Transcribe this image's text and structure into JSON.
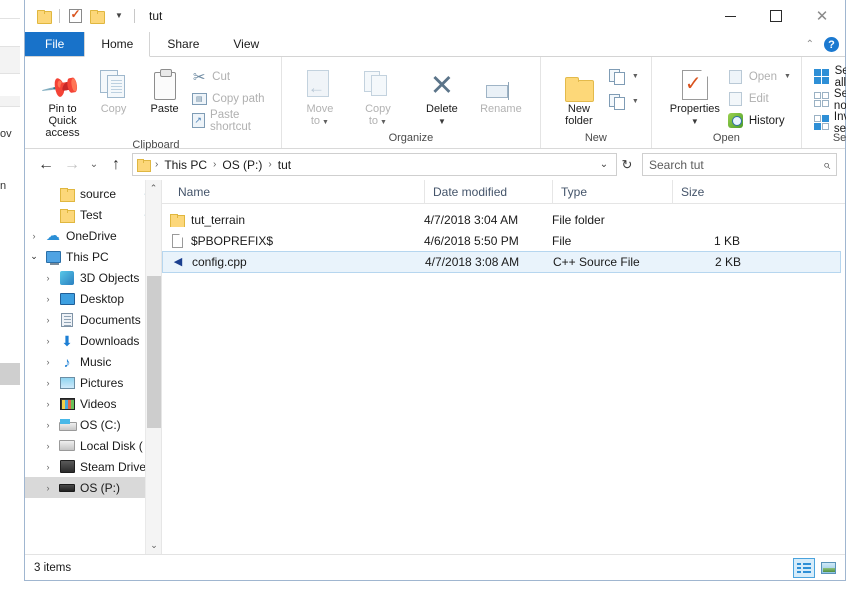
{
  "window": {
    "title": "tut",
    "controls": {
      "minimize": "minimize-button",
      "maximize": "maximize-button",
      "close": "close-button"
    }
  },
  "quick_access_toolbar": {
    "items": [
      {
        "name": "folder-icon",
        "label": ""
      },
      {
        "name": "properties-icon",
        "label": ""
      },
      {
        "name": "new-folder-icon",
        "label": ""
      },
      {
        "name": "customize-dropdown",
        "label": ""
      }
    ]
  },
  "ribbon": {
    "tabs": [
      {
        "label": "File",
        "active": false,
        "style": "file"
      },
      {
        "label": "Home",
        "active": true,
        "style": "normal"
      },
      {
        "label": "Share",
        "active": false,
        "style": "normal"
      },
      {
        "label": "View",
        "active": false,
        "style": "normal"
      }
    ],
    "collapse_label": "^",
    "help_label": "?",
    "groups": [
      {
        "label": "Clipboard",
        "big_buttons": [
          {
            "label": "Pin to Quick\naccess",
            "line1": "Pin to Quick",
            "line2": "access",
            "icon": "pin-icon",
            "disabled": false
          },
          {
            "label": "Copy",
            "icon": "copy-icon",
            "disabled": true
          },
          {
            "label": "Paste",
            "icon": "paste-icon",
            "disabled": false
          }
        ],
        "small_buttons": [
          {
            "label": "Cut",
            "icon": "scissors-icon",
            "disabled": true
          },
          {
            "label": "Copy path",
            "icon": "copy-path-icon",
            "disabled": true
          },
          {
            "label": "Paste shortcut",
            "icon": "paste-shortcut-icon",
            "disabled": true
          }
        ]
      },
      {
        "label": "Organize",
        "big_buttons": [
          {
            "label": "Move",
            "line1": "Move",
            "line2": "to",
            "icon": "move-to-icon",
            "disabled": true,
            "caret": true
          },
          {
            "label": "Copy",
            "line1": "Copy",
            "line2": "to",
            "icon": "copy-to-icon",
            "disabled": true,
            "caret": true
          },
          {
            "label": "Delete",
            "line1": "Delete",
            "line2": "",
            "icon": "delete-icon",
            "disabled": false,
            "caret": true
          },
          {
            "label": "Rename",
            "line1": "Rename",
            "line2": "",
            "icon": "rename-icon",
            "disabled": true,
            "caret": false
          }
        ],
        "small_buttons": []
      },
      {
        "label": "New",
        "big_buttons": [
          {
            "label": "New folder",
            "line1": "New",
            "line2": "folder",
            "icon": "new-folder-icon",
            "disabled": false
          }
        ],
        "small_buttons": [
          {
            "label": "",
            "icon": "new-item-icon",
            "disabled": false
          },
          {
            "label": "",
            "icon": "easy-access-icon",
            "disabled": false
          }
        ]
      },
      {
        "label": "Open",
        "big_buttons": [
          {
            "label": "Properties",
            "line1": "Properties",
            "line2": "",
            "icon": "properties-icon",
            "disabled": false,
            "caret": true
          }
        ],
        "small_buttons": [
          {
            "label": "Open",
            "icon": "open-icon",
            "disabled": true,
            "caret": true
          },
          {
            "label": "Edit",
            "icon": "edit-icon",
            "disabled": true
          },
          {
            "label": "History",
            "icon": "history-icon",
            "disabled": false
          }
        ]
      },
      {
        "label": "Select",
        "big_buttons": [],
        "small_buttons": [
          {
            "label": "Select all",
            "icon": "select-all-icon",
            "disabled": false
          },
          {
            "label": "Select none",
            "icon": "select-none-icon",
            "disabled": false
          },
          {
            "label": "Invert selection",
            "icon": "invert-selection-icon",
            "disabled": false
          }
        ]
      }
    ]
  },
  "address_bar": {
    "back_label": "←",
    "forward_label": "→",
    "recent_label": "⌄",
    "up_label": "↑",
    "breadcrumbs": [
      "This PC",
      "OS (P:)",
      "tut"
    ],
    "separator": "›",
    "dropdown_label": "⌄",
    "refresh_label": "↻"
  },
  "search": {
    "placeholder": "Search tut",
    "icon": "search-icon"
  },
  "nav_pane": {
    "items": [
      {
        "label": "source",
        "indent": 1,
        "expander": "",
        "icon": "folder-icon",
        "pinned": true,
        "selected": false
      },
      {
        "label": "Test",
        "indent": 1,
        "expander": "",
        "icon": "folder-icon",
        "pinned": true,
        "selected": false
      },
      {
        "label": "OneDrive",
        "indent": 0,
        "expander": "›",
        "icon": "onedrive-cloud-icon",
        "pinned": false,
        "selected": false
      },
      {
        "label": "This PC",
        "indent": 0,
        "expander": "⌄",
        "icon": "this-pc-icon",
        "pinned": false,
        "selected": false
      },
      {
        "label": "3D Objects",
        "indent": 1,
        "expander": "›",
        "icon": "3d-objects-icon",
        "pinned": false,
        "selected": false
      },
      {
        "label": "Desktop",
        "indent": 1,
        "expander": "›",
        "icon": "desktop-icon",
        "pinned": false,
        "selected": false
      },
      {
        "label": "Documents",
        "indent": 1,
        "expander": "›",
        "icon": "documents-icon",
        "pinned": false,
        "selected": false
      },
      {
        "label": "Downloads",
        "indent": 1,
        "expander": "›",
        "icon": "downloads-icon",
        "pinned": false,
        "selected": false
      },
      {
        "label": "Music",
        "indent": 1,
        "expander": "›",
        "icon": "music-icon",
        "pinned": false,
        "selected": false
      },
      {
        "label": "Pictures",
        "indent": 1,
        "expander": "›",
        "icon": "pictures-icon",
        "pinned": false,
        "selected": false
      },
      {
        "label": "Videos",
        "indent": 1,
        "expander": "›",
        "icon": "videos-icon",
        "pinned": false,
        "selected": false
      },
      {
        "label": "OS (C:)",
        "indent": 1,
        "expander": "›",
        "icon": "os-drive-icon",
        "pinned": false,
        "selected": false
      },
      {
        "label": "Local Disk (",
        "indent": 1,
        "expander": "›",
        "icon": "local-disk-icon",
        "pinned": false,
        "selected": false
      },
      {
        "label": "Steam Drive",
        "indent": 1,
        "expander": "›",
        "icon": "steam-drive-icon",
        "pinned": false,
        "selected": false
      },
      {
        "label": "OS (P:)",
        "indent": 1,
        "expander": "›",
        "icon": "os-p-drive-icon",
        "pinned": false,
        "selected": true
      }
    ],
    "scroll_up": "⌃",
    "scroll_down": "⌄"
  },
  "file_list": {
    "columns": [
      "Name",
      "Date modified",
      "Type",
      "Size"
    ],
    "rows": [
      {
        "name": "tut_terrain",
        "date_modified": "4/7/2018 3:04 AM",
        "type": "File folder",
        "size": "",
        "icon": "folder-icon",
        "selected": false
      },
      {
        "name": "$PBOPREFIX$",
        "date_modified": "4/6/2018 5:50 PM",
        "type": "File",
        "size": "1 KB",
        "icon": "generic-file-icon",
        "selected": false
      },
      {
        "name": "config.cpp",
        "date_modified": "4/7/2018 3:08 AM",
        "type": "C++ Source File",
        "size": "2 KB",
        "icon": "cpp-source-file-icon",
        "selected": true
      }
    ]
  },
  "status_bar": {
    "item_count": "3 items",
    "view_details_icon": "details-view-icon",
    "view_large_icon": "large-icons-view-icon"
  },
  "background_window": {
    "text_fragments": [
      "ov",
      "n"
    ]
  },
  "colors": {
    "accent": "#1872c9",
    "selection_fill": "#e9f3fb",
    "selection_border": "#b6d6ef",
    "nav_selection": "#d9d9d9",
    "folder_yellow": "#fcd77a",
    "header_text": "#44546a"
  }
}
